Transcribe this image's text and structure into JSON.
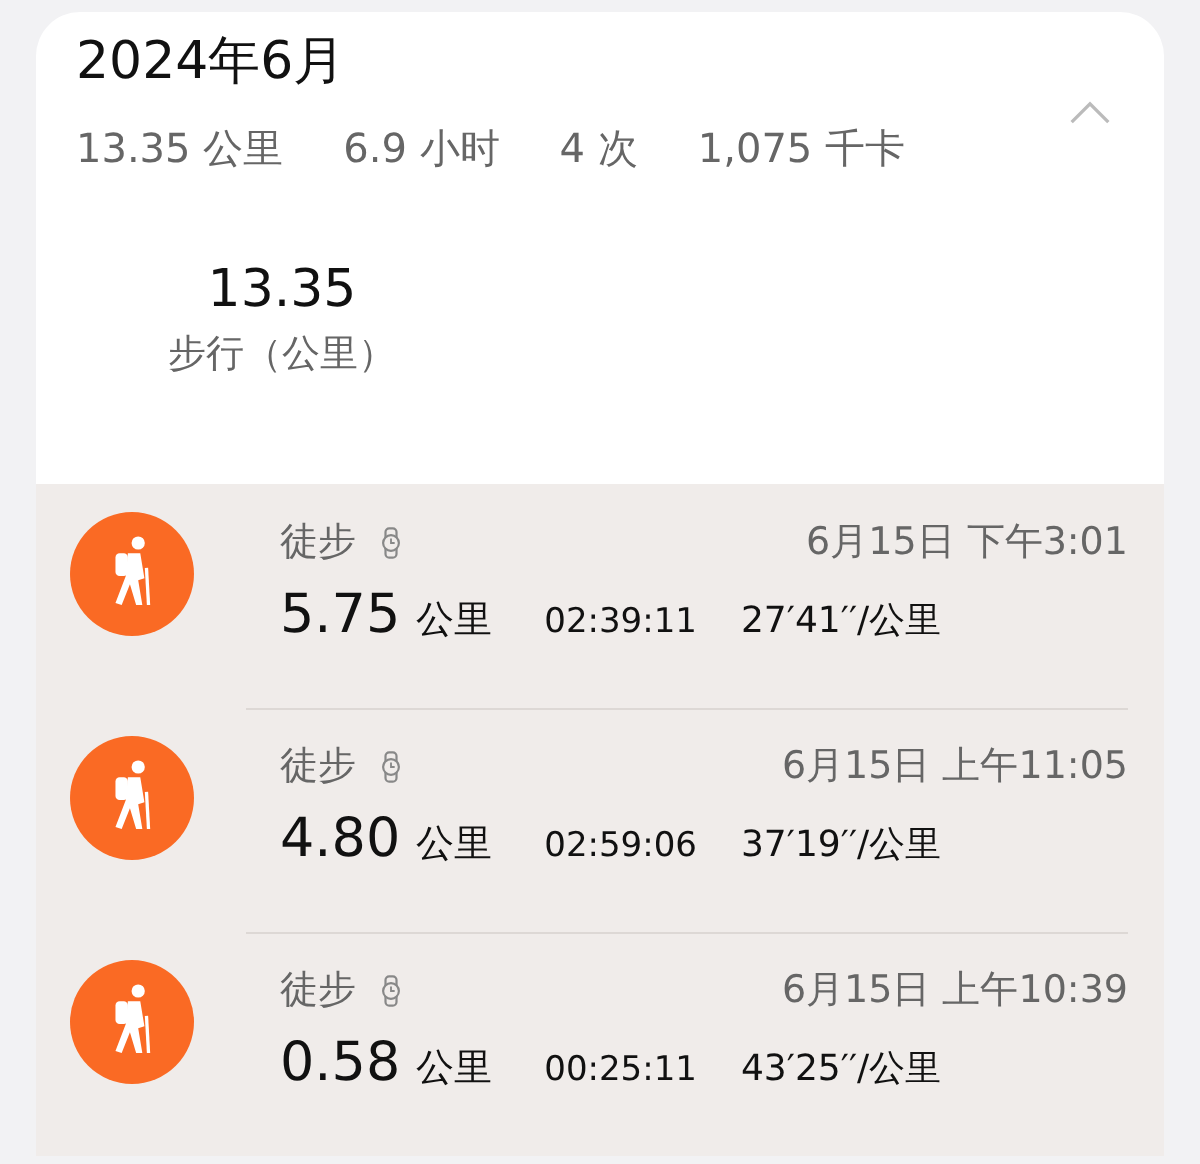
{
  "header": {
    "title": "2024年6月",
    "expanded": true,
    "stats": [
      "13.35 公里",
      "6.9 小时",
      "4 次",
      "1,075 千卡"
    ]
  },
  "summary": {
    "value": "13.35",
    "label": "步行（公里）"
  },
  "activities": [
    {
      "type": "徒步",
      "datetime": "6月15日 下午3:01",
      "distance": "5.75",
      "unit": "公里",
      "duration": "02:39:11",
      "pace": "27′41′′/公里"
    },
    {
      "type": "徒步",
      "datetime": "6月15日 上午11:05",
      "distance": "4.80",
      "unit": "公里",
      "duration": "02:59:06",
      "pace": "37′19′′/公里"
    },
    {
      "type": "徒步",
      "datetime": "6月15日 上午10:39",
      "distance": "0.58",
      "unit": "公里",
      "duration": "00:25:11",
      "pace": "43′25′′/公里"
    }
  ]
}
